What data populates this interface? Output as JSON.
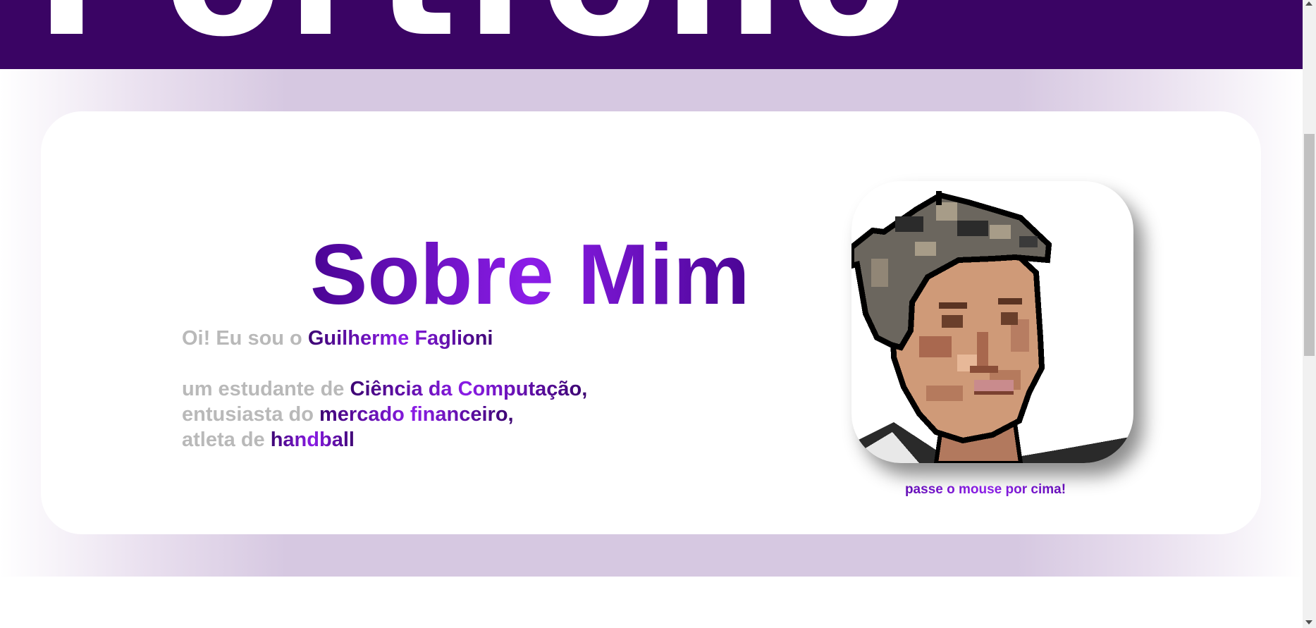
{
  "header": {
    "title": "Portfólio"
  },
  "about": {
    "title": "Sobre Mim",
    "intro_prefix": "Oi! Eu sou o ",
    "name": "Guilherme Faglioni",
    "line1_prefix": "um estudante de ",
    "line1_highlight": "Ciência da Computação",
    "line2_prefix": "entusiasta do ",
    "line2_highlight": "mercado financeiro",
    "line3_prefix": "atleta de ",
    "line3_highlight": "handball",
    "comma": ","
  },
  "avatar": {
    "hint": "passe o mouse por cima!"
  },
  "colors": {
    "header_bg": "#3a0464",
    "accent_dark": "#3d0473",
    "accent_light": "#8b1de8",
    "muted_text": "#b9b9b9",
    "band": "#d6c8e1"
  }
}
